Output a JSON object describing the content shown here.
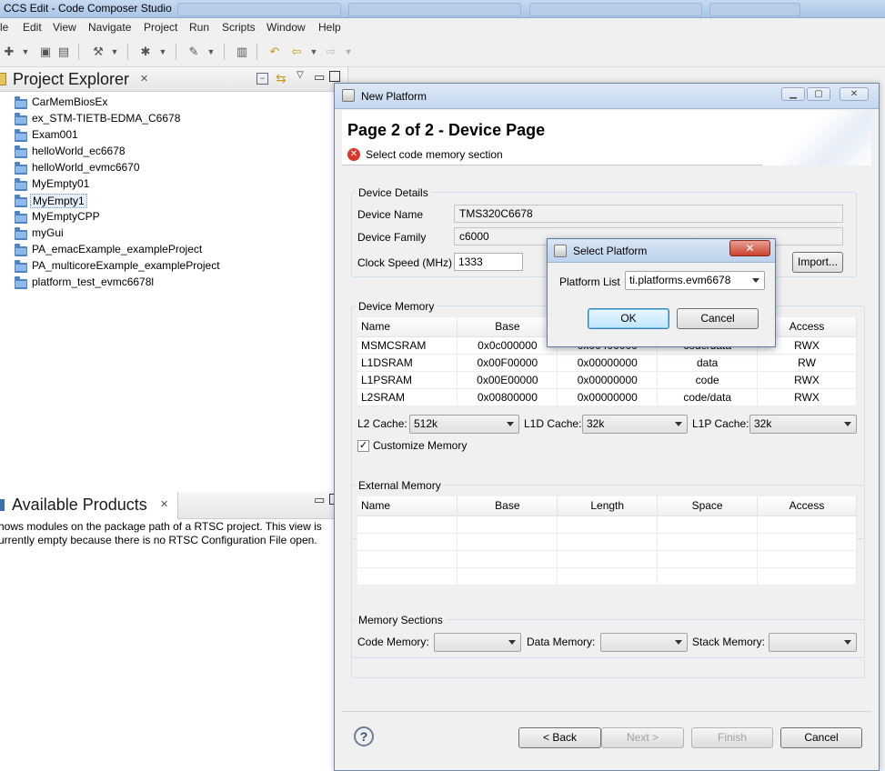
{
  "window": {
    "title": "CCS Edit - Code Composer Studio"
  },
  "menubar": {
    "items": [
      "File",
      "Edit",
      "View",
      "Navigate",
      "Project",
      "Run",
      "Scripts",
      "Window",
      "Help"
    ],
    "display": [
      "le",
      "Edit",
      "View",
      "Navigate",
      "Project",
      "Run",
      "Scripts",
      "Window",
      "Help"
    ]
  },
  "project_explorer": {
    "title": "Project Explorer",
    "close_glyph": "✕",
    "projects": [
      "CarMemBiosEx",
      "ex_STM-TIETB-EDMA_C6678",
      "Exam001",
      "helloWorld_ec6678",
      "helloWorld_evmc6670",
      "MyEmpty01",
      "MyEmpty1",
      "MyEmptyCPP",
      "myGui",
      "PA_emacExample_exampleProject",
      "PA_multicoreExample_exampleProject",
      "platform_test_evmc6678l"
    ],
    "selected_project": "MyEmpty1"
  },
  "available_products": {
    "title": "Available Products",
    "close_glyph": "✕",
    "line1": "hows modules on the package path of a RTSC project. This view is",
    "line2": "urrently empty because there is no RTSC Configuration File open."
  },
  "new_platform": {
    "title": "New Platform",
    "page_title": "Page 2 of 2 - Device Page",
    "error_message": "Select code memory section",
    "device_details": {
      "label": "Device Details",
      "device_name_label": "Device Name",
      "device_name_value": "TMS320C6678",
      "device_family_label": "Device Family",
      "device_family_value": "c6000",
      "clock_speed_label": "Clock Speed (MHz)",
      "clock_speed_value": "1333",
      "import_button": "Import..."
    },
    "device_memory": {
      "label": "Device Memory",
      "columns": [
        "Name",
        "Base",
        "Length",
        "Space",
        "Access"
      ],
      "rows": [
        [
          "MSMCSRAM",
          "0x0c000000",
          "0x00400000",
          "code/data",
          "RWX"
        ],
        [
          "L1DSRAM",
          "0x00F00000",
          "0x00000000",
          "data",
          "RW"
        ],
        [
          "L1PSRAM",
          "0x00E00000",
          "0x00000000",
          "code",
          "RWX"
        ],
        [
          "L2SRAM",
          "0x00800000",
          "0x00000000",
          "code/data",
          "RWX"
        ]
      ],
      "l2_cache_label": "L2 Cache:",
      "l2_cache_value": "512k",
      "l1d_cache_label": "L1D Cache:",
      "l1d_cache_value": "32k",
      "l1p_cache_label": "L1P Cache:",
      "l1p_cache_value": "32k",
      "customize_memory_label": "Customize Memory",
      "customize_memory_checked": true,
      "check_glyph": "✓"
    },
    "external_memory": {
      "label": "External Memory",
      "columns": [
        "Name",
        "Base",
        "Length",
        "Space",
        "Access"
      ]
    },
    "memory_sections": {
      "label": "Memory Sections",
      "code_memory_label": "Code Memory:",
      "data_memory_label": "Data Memory:",
      "stack_memory_label": "Stack Memory:"
    },
    "buttons": {
      "back": "< Back",
      "next": "Next >",
      "finish": "Finish",
      "cancel": "Cancel"
    },
    "help_glyph": "?"
  },
  "select_platform": {
    "title": "Select Platform",
    "platform_list_label": "Platform List",
    "platform_list_value": "ti.platforms.evm6678",
    "ok_button": "OK",
    "cancel_button": "Cancel",
    "close_glyph": "✕"
  },
  "colors": {
    "title_gradient_top": "#c7daf0",
    "folder_blue": "#4f84c4",
    "error_red": "#d9372b",
    "close_red": "#c9412f"
  }
}
